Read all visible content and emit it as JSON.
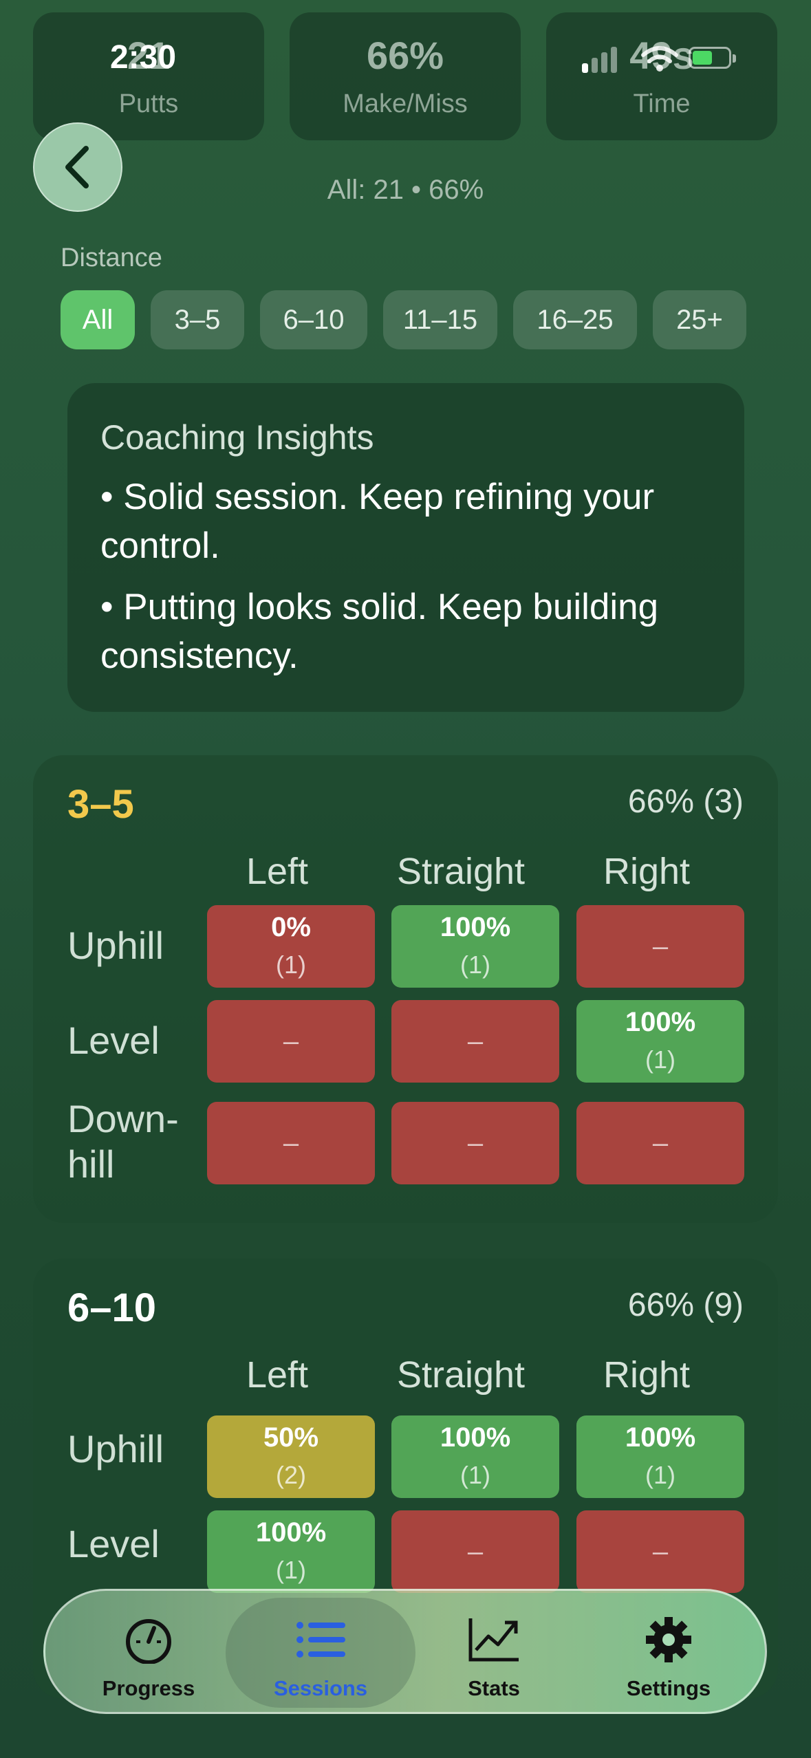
{
  "status_bar": {
    "time": "2:30"
  },
  "summary_cards": [
    {
      "value": "21",
      "label": "Putts"
    },
    {
      "value": "66%",
      "label": "Make/Miss"
    },
    {
      "value": "49s",
      "label": "Time"
    }
  ],
  "header": {
    "subtitle": "All: 21 • 66%"
  },
  "distance_filter": {
    "label": "Distance",
    "options": [
      "All",
      "3–5",
      "6–10",
      "11–15",
      "16–25",
      "25+"
    ],
    "selected": "All"
  },
  "insights": {
    "title": "Coaching Insights",
    "items": [
      "• Solid session. Keep refining your control.",
      "• Putting looks solid. Keep building consistency."
    ]
  },
  "grid_labels": {
    "columns": [
      "Left",
      "Straight",
      "Right"
    ],
    "rows": [
      "Uphill",
      "Level",
      "Down-hill"
    ]
  },
  "sections": [
    {
      "title": "3–5",
      "title_color": "#f2c94c",
      "summary": "66% (3)",
      "cells": [
        [
          {
            "pct": "0%",
            "count": "(1)",
            "status": "red"
          },
          {
            "pct": "100%",
            "count": "(1)",
            "status": "green"
          },
          {
            "pct": "–",
            "count": "",
            "status": "red"
          }
        ],
        [
          {
            "pct": "–",
            "count": "",
            "status": "red"
          },
          {
            "pct": "–",
            "count": "",
            "status": "red"
          },
          {
            "pct": "100%",
            "count": "(1)",
            "status": "green"
          }
        ],
        [
          {
            "pct": "–",
            "count": "",
            "status": "red"
          },
          {
            "pct": "–",
            "count": "",
            "status": "red"
          },
          {
            "pct": "–",
            "count": "",
            "status": "red"
          }
        ]
      ]
    },
    {
      "title": "6–10",
      "title_color": "#ffffff",
      "summary": "66% (9)",
      "cells": [
        [
          {
            "pct": "50%",
            "count": "(2)",
            "status": "yellow"
          },
          {
            "pct": "100%",
            "count": "(1)",
            "status": "green"
          },
          {
            "pct": "100%",
            "count": "(1)",
            "status": "green"
          }
        ],
        [
          {
            "pct": "100%",
            "count": "(1)",
            "status": "green"
          },
          {
            "pct": "–",
            "count": "",
            "status": "red"
          },
          {
            "pct": "–",
            "count": "",
            "status": "red"
          }
        ]
      ]
    }
  ],
  "tab_bar": {
    "tabs": [
      {
        "label": "Progress",
        "icon": "gauge-icon"
      },
      {
        "label": "Sessions",
        "icon": "list-icon"
      },
      {
        "label": "Stats",
        "icon": "chart-icon"
      },
      {
        "label": "Settings",
        "icon": "gear-icon"
      }
    ],
    "active": "Sessions",
    "active_color": "#2a5fe0"
  }
}
